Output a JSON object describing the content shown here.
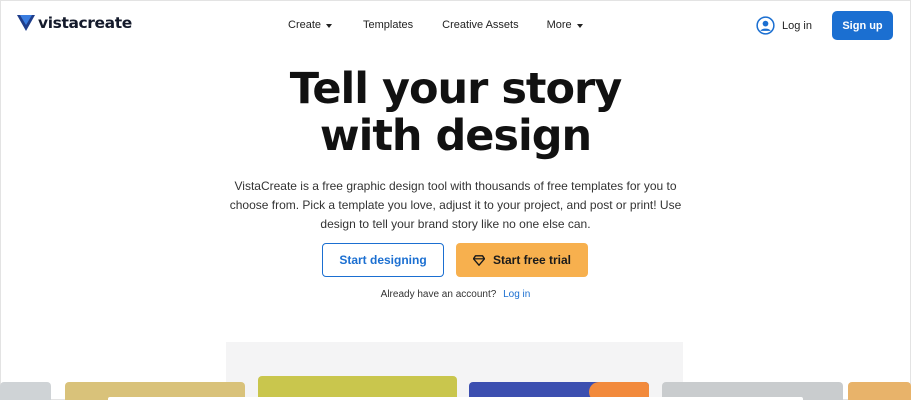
{
  "brand": {
    "name": "vistacreate",
    "accent": "#1b6fd1",
    "trial_color": "#f7b04e"
  },
  "nav": {
    "items": [
      {
        "label": "Create",
        "dropdown": true
      },
      {
        "label": "Templates",
        "dropdown": false
      },
      {
        "label": "Creative Assets",
        "dropdown": false
      },
      {
        "label": "More",
        "dropdown": true
      }
    ]
  },
  "auth": {
    "login_label": "Log in",
    "signup_label": "Sign up",
    "login_icon": "user-circle-icon"
  },
  "hero": {
    "title_line1": "Tell your story",
    "title_line2": "with design",
    "description_line1": "VistaCreate is a free graphic design tool with thousands of free templates for you to",
    "description_line2": "choose from. Pick a template you love, adjust it to your project, and post or print! Use",
    "description_line3": "design to tell your brand story like no one else can.",
    "primary_button": "Start designing",
    "trial_button": "Start free trial",
    "trial_icon": "diamond-icon",
    "account_prompt": "Already have an account?",
    "account_link": "Log in"
  }
}
